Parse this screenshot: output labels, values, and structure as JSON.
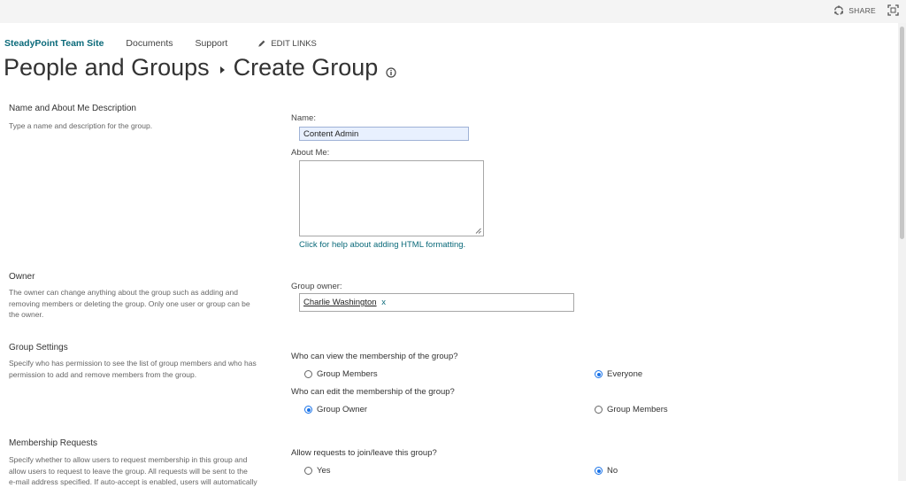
{
  "topbar": {
    "share_label": "SHARE",
    "share_icon": "sync-circle-icon",
    "focus_icon": "focus-mode-icon"
  },
  "nav": {
    "site": "SteadyPoint Team Site",
    "links": [
      "Documents",
      "Support"
    ],
    "edit_links": "EDIT LINKS",
    "edit_icon": "pencil-icon"
  },
  "title": {
    "parent": "People and Groups",
    "current": "Create Group",
    "info_icon": "info-icon"
  },
  "sections": {
    "name": {
      "title": "Name and About Me Description",
      "description": "Type a name and description for the group."
    },
    "owner": {
      "title": "Owner",
      "description_lines": [
        "The owner can change anything about the group such as adding and",
        "removing members or deleting the group. Only one user or group can be",
        "the owner."
      ]
    },
    "settings": {
      "title": "Group Settings",
      "description_lines": [
        "Specify who has permission to see the list of group members and who has",
        "permission to add and remove members from the group."
      ]
    },
    "membership": {
      "title": "Membership Requests",
      "description_lines": [
        "Specify whether to allow users to request membership in this group and",
        "allow users to request to leave the group. All requests will be sent to the",
        "e-mail address specified. If auto-accept is enabled, users will automatically"
      ]
    }
  },
  "form": {
    "name_label": "Name:",
    "name_value": "Content Admin",
    "about_label": "About Me:",
    "about_value": "",
    "help_link": "Click for help about adding HTML formatting.",
    "owner_label": "Group owner:",
    "owner_value": "Charlie Washington",
    "owner_remove": "x",
    "view_question": "Who can view the membership of the group?",
    "view_options": [
      "Group Members",
      "Everyone"
    ],
    "view_selected": "Everyone",
    "edit_question": "Who can edit the membership of the group?",
    "edit_options": [
      "Group Owner",
      "Group Members"
    ],
    "edit_selected": "Group Owner",
    "requests_question": "Allow requests to join/leave this group?",
    "requests_options": [
      "Yes",
      "No"
    ],
    "requests_selected": "No"
  },
  "colors": {
    "link": "#0b6a7a",
    "radio_selected": "#1a73e8",
    "name_field_bg": "#e8f0fe"
  }
}
